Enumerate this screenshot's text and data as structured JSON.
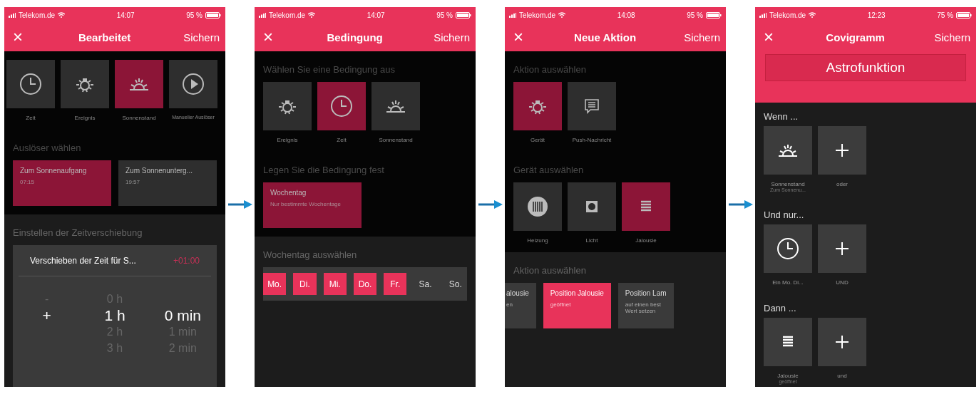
{
  "phones": [
    {
      "status": {
        "carrier": "Telekom.de",
        "time": "14:07",
        "battery": "95 %"
      },
      "header": {
        "close": "×",
        "title": "Bearbeitet",
        "action": "Sichern"
      },
      "sections": [
        {
          "kind": "tiles",
          "dimmed": true,
          "tiles": [
            {
              "kind": "clock",
              "label": "Zeit",
              "selected": false
            },
            {
              "kind": "bulb",
              "label": "Ereignis",
              "selected": false
            },
            {
              "kind": "sunrise",
              "label": "Sonnenstand",
              "selected": true
            },
            {
              "kind": "play",
              "label": "Manueller Auslöser",
              "selected": false
            }
          ]
        },
        {
          "kind": "cards",
          "dimmed": true,
          "heading": "Auslöser wählen",
          "cards": [
            {
              "title": "Zum Sonnenaufgang",
              "subtitle": "07:15",
              "selected": true
            },
            {
              "title": "Zum Sonnenunterg...",
              "subtitle": "19:57",
              "selected": false
            }
          ]
        },
        {
          "kind": "picker",
          "dimmed": false,
          "heading": "Einstellen der Zeitverschiebung",
          "title": "Verschieben der Zeit für S...",
          "value": "+01:00",
          "columns": [
            {
              "items": [
                {
                  "label": "-",
                  "selected": false
                },
                {
                  "label": "+",
                  "selected": true
                }
              ]
            },
            {
              "items": [
                {
                  "label": "0 h",
                  "selected": false
                },
                {
                  "label": "1 h",
                  "selected": true
                },
                {
                  "label": "2 h",
                  "selected": false
                },
                {
                  "label": "3 h",
                  "selected": false
                }
              ]
            },
            {
              "items": [
                {
                  "label": "0 min",
                  "selected": true
                },
                {
                  "label": "1 min",
                  "selected": false
                },
                {
                  "label": "2 min",
                  "selected": false
                }
              ]
            }
          ]
        }
      ]
    },
    {
      "status": {
        "carrier": "Telekom.de",
        "time": "14:07",
        "battery": "95 %"
      },
      "header": {
        "close": "×",
        "title": "Bedingung",
        "action": "Sichern"
      },
      "sections": [
        {
          "kind": "tiles",
          "dimmed": true,
          "heading": "Wählen Sie eine Bedingung aus",
          "tiles": [
            {
              "kind": "bulb",
              "label": "Ereignis",
              "selected": false
            },
            {
              "kind": "clock",
              "label": "Zeit",
              "selected": true
            },
            {
              "kind": "sunrise",
              "label": "Sonnenstand",
              "selected": false
            }
          ]
        },
        {
          "kind": "cards",
          "dimmed": true,
          "heading": "Legen Sie die Bedingung fest",
          "cards": [
            {
              "title": "Wochentag",
              "subtitle": "Nur bestimmte Wochentage",
              "selected": true
            }
          ]
        },
        {
          "kind": "days",
          "dimmed": false,
          "heading": "Wochentag auswählen",
          "days": [
            {
              "label": "Mo.",
              "selected": true
            },
            {
              "label": "Di.",
              "selected": true
            },
            {
              "label": "Mi.",
              "selected": true
            },
            {
              "label": "Do.",
              "selected": true
            },
            {
              "label": "Fr.",
              "selected": true
            },
            {
              "label": "Sa.",
              "selected": false
            },
            {
              "label": "So.",
              "selected": false
            }
          ]
        }
      ]
    },
    {
      "status": {
        "carrier": "Telekom.de",
        "time": "14:08",
        "battery": "95 %"
      },
      "header": {
        "close": "×",
        "title": "Neue Aktion",
        "action": "Sichern"
      },
      "sections": [
        {
          "kind": "tiles",
          "dimmed": true,
          "heading": "Aktion auswählen",
          "tiles": [
            {
              "kind": "bulb",
              "label": "Gerät",
              "selected": true
            },
            {
              "kind": "chat",
              "label": "Push-Nachricht",
              "selected": false
            }
          ]
        },
        {
          "kind": "tiles",
          "dimmed": true,
          "heading": "Gerät auswählen",
          "tiles": [
            {
              "kind": "radiator",
              "label": "Heizung",
              "selected": false
            },
            {
              "kind": "socket",
              "label": "Licht",
              "selected": false
            },
            {
              "kind": "blinds",
              "label": "Jalousie",
              "selected": true
            }
          ]
        },
        {
          "kind": "cards",
          "dimmed": false,
          "scrolled": true,
          "heading": "Aktion auswählen",
          "cards": [
            {
              "title": "alousie",
              "subtitle": "en",
              "selected": false
            },
            {
              "title": "Position Jalousie",
              "subtitle": "geöffnet",
              "selected": true
            },
            {
              "title": "Position Lam",
              "subtitle": "auf einen best Wert setzen",
              "selected": false
            }
          ]
        }
      ]
    },
    {
      "status": {
        "carrier": "Telekom.de",
        "time": "12:23",
        "battery": "75 %"
      },
      "header": {
        "close": "×",
        "title": "Covigramm",
        "action": "Sichern"
      },
      "banner": "Astrofunktion",
      "sections": [
        {
          "kind": "group",
          "dimmed": false,
          "heading": "Wenn ...",
          "tiles": [
            {
              "kind": "sunrise",
              "label": "Sonnenstand",
              "sublabel": "Zum Sonnenu...",
              "selected": false
            },
            {
              "kind": "plus",
              "label": "oder",
              "selected": false
            }
          ]
        },
        {
          "kind": "group",
          "dimmed": false,
          "heading": "Und nur...",
          "tiles": [
            {
              "kind": "clock",
              "label": "Ein Mo. Di...",
              "selected": false
            },
            {
              "kind": "plus",
              "label": "UND",
              "selected": false
            }
          ]
        },
        {
          "kind": "group",
          "dimmed": false,
          "heading": "Dann ...",
          "tiles": [
            {
              "kind": "blinds",
              "label": "Jalousie",
              "sublabel": "geöffnet",
              "selected": false
            },
            {
              "kind": "plus",
              "label": "und",
              "selected": false
            }
          ]
        }
      ]
    }
  ]
}
